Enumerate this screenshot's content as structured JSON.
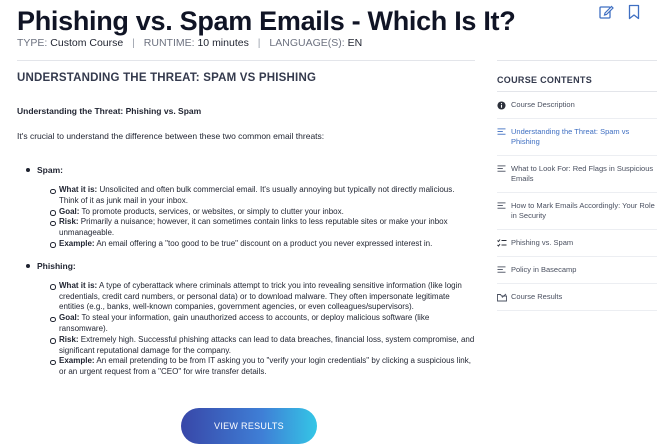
{
  "page": {
    "title": "Phishing vs. Spam Emails - Which Is It?",
    "type_label": "TYPE:",
    "type_value": "Custom Course",
    "runtime_label": "RUNTIME:",
    "runtime_value": "10 minutes",
    "language_label": "LANGUAGE(S):",
    "language_value": "EN",
    "icons": [
      "edit-icon",
      "bookmark-icon"
    ]
  },
  "content": {
    "section_heading": "UNDERSTANDING THE THREAT: SPAM VS PHISHING",
    "sub_heading": "Understanding the Threat: Phishing vs. Spam",
    "intro": "It's crucial to understand the difference between these two common email threats:",
    "groups": [
      {
        "label": "Spam:",
        "items": [
          {
            "term": "What it is:",
            "text": "Unsolicited and often bulk commercial email. It's usually annoying but typically not directly malicious. Think of it as junk mail in your inbox."
          },
          {
            "term": "Goal:",
            "text": "To promote products, services, or websites, or simply to clutter your inbox."
          },
          {
            "term": "Risk:",
            "text": "Primarily a nuisance; however, it can sometimes contain links to less reputable sites or make your inbox unmanageable."
          },
          {
            "term": "Example:",
            "text": "An email offering a \"too good to be true\" discount on a product you never expressed interest in."
          }
        ]
      },
      {
        "label": "Phishing:",
        "items": [
          {
            "term": "What it is:",
            "text": "A type of cyberattack where criminals attempt to trick you into revealing sensitive information (like login credentials, credit card numbers, or personal data) or to download malware. They often impersonate legitimate entities (e.g., banks, well-known companies, government agencies, or even colleagues/supervisors)."
          },
          {
            "term": "Goal:",
            "text": "To steal your information, gain unauthorized access to accounts, or deploy malicious software (like ransomware)."
          },
          {
            "term": "Risk:",
            "text": "Extremely high. Successful phishing attacks can lead to data breaches, financial loss, system compromise, and significant reputational damage for the company."
          },
          {
            "term": "Example:",
            "text": "An email pretending to be from IT asking you to \"verify your login credentials\" by clicking a suspicious link, or an urgent request from a \"CEO\" for wire transfer details."
          }
        ]
      }
    ],
    "cta_label": "VIEW RESULTS"
  },
  "sidebar": {
    "title": "COURSE CONTENTS",
    "items": [
      {
        "label": "Course Description",
        "icon": "info-icon",
        "active": false
      },
      {
        "label": "Understanding the Threat: Spam vs Phishing",
        "icon": "lines-icon",
        "active": true
      },
      {
        "label": "What to Look For: Red Flags in Suspicious Emails",
        "icon": "lines-icon",
        "active": false
      },
      {
        "label": "How to Mark Emails Accordingly: Your Role in Security",
        "icon": "lines-icon",
        "active": false
      },
      {
        "label": "Phishing vs. Spam",
        "icon": "quiz-icon",
        "active": false
      },
      {
        "label": "Policy in Basecamp",
        "icon": "lines-icon",
        "active": false
      },
      {
        "label": "Course Results",
        "icon": "results-icon",
        "active": false
      }
    ]
  },
  "colors": {
    "accent": "#3f6fc2",
    "cta_gradient_start": "#3847a8",
    "cta_gradient_end": "#34c6e6",
    "title": "#101425"
  }
}
